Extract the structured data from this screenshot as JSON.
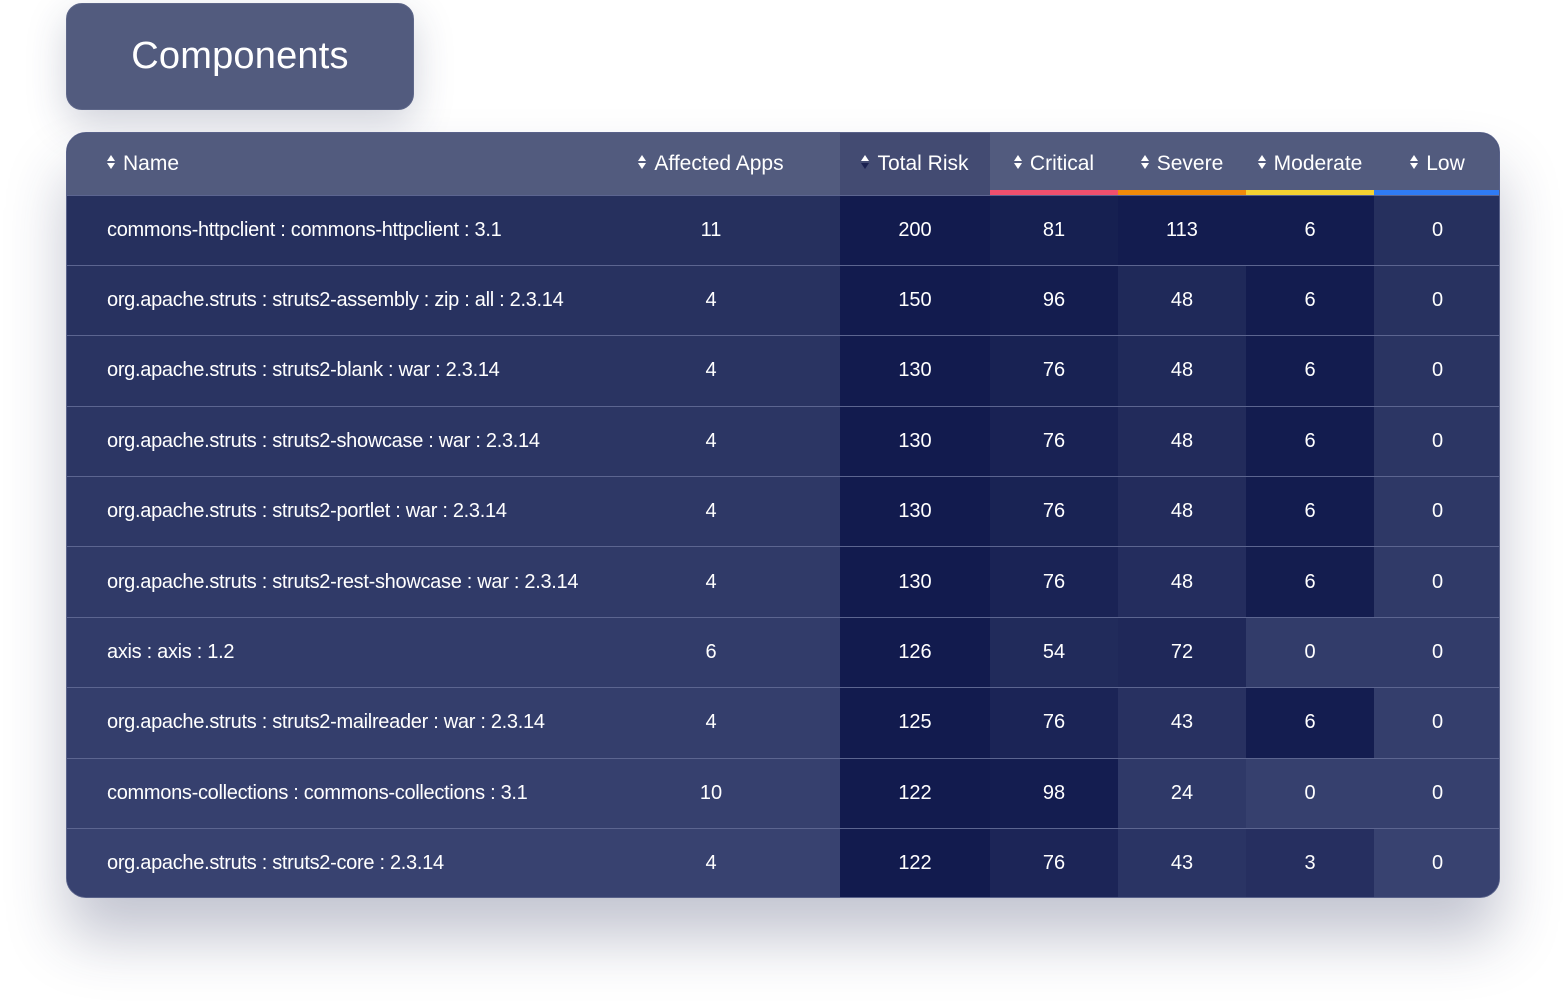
{
  "title": "Components",
  "table": {
    "columns": [
      {
        "key": "name",
        "label": "Name",
        "sort": "none"
      },
      {
        "key": "affected_apps",
        "label": "Affected Apps",
        "sort": "none"
      },
      {
        "key": "total_risk",
        "label": "Total Risk",
        "sort": "desc"
      },
      {
        "key": "critical",
        "label": "Critical",
        "sort": "none",
        "color": "#f0506e"
      },
      {
        "key": "severe",
        "label": "Severe",
        "sort": "none",
        "color": "#f08a0a"
      },
      {
        "key": "moderate",
        "label": "Moderate",
        "sort": "none",
        "color": "#f5d232"
      },
      {
        "key": "low",
        "label": "Low",
        "sort": "none",
        "color": "#2f7bf5"
      }
    ],
    "sort_icon": "sort-up-down-icon",
    "rows": [
      {
        "name": "commons-httpclient : commons-httpclient : 3.1",
        "affected_apps": "11",
        "total_risk": "200",
        "critical": "81",
        "severe": "113",
        "moderate": "6",
        "low": "0"
      },
      {
        "name": "org.apache.struts : struts2-assembly : zip : all : 2.3.14",
        "affected_apps": "4",
        "total_risk": "150",
        "critical": "96",
        "severe": "48",
        "moderate": "6",
        "low": "0"
      },
      {
        "name": "org.apache.struts : struts2-blank : war : 2.3.14",
        "affected_apps": "4",
        "total_risk": "130",
        "critical": "76",
        "severe": "48",
        "moderate": "6",
        "low": "0"
      },
      {
        "name": "org.apache.struts : struts2-showcase : war : 2.3.14",
        "affected_apps": "4",
        "total_risk": "130",
        "critical": "76",
        "severe": "48",
        "moderate": "6",
        "low": "0"
      },
      {
        "name": "org.apache.struts : struts2-portlet : war : 2.3.14",
        "affected_apps": "4",
        "total_risk": "130",
        "critical": "76",
        "severe": "48",
        "moderate": "6",
        "low": "0"
      },
      {
        "name": "org.apache.struts : struts2-rest-showcase : war : 2.3.14",
        "affected_apps": "4",
        "total_risk": "130",
        "critical": "76",
        "severe": "48",
        "moderate": "6",
        "low": "0"
      },
      {
        "name": "axis : axis : 1.2",
        "affected_apps": "6",
        "total_risk": "126",
        "critical": "54",
        "severe": "72",
        "moderate": "0",
        "low": "0"
      },
      {
        "name": "org.apache.struts : struts2-mailreader : war : 2.3.14",
        "affected_apps": "4",
        "total_risk": "125",
        "critical": "76",
        "severe": "43",
        "moderate": "6",
        "low": "0"
      },
      {
        "name": "commons-collections : commons-collections : 3.1",
        "affected_apps": "10",
        "total_risk": "122",
        "critical": "98",
        "severe": "24",
        "moderate": "0",
        "low": "0"
      },
      {
        "name": "org.apache.struts : struts2-core : 2.3.14",
        "affected_apps": "4",
        "total_risk": "122",
        "critical": "76",
        "severe": "43",
        "moderate": "3",
        "low": "0"
      }
    ]
  }
}
